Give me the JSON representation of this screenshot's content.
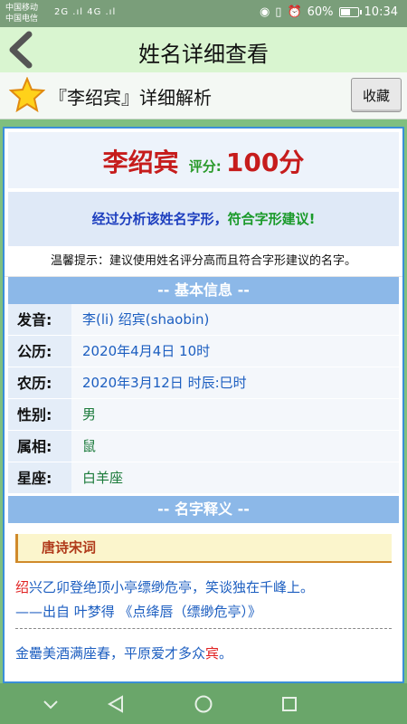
{
  "status": {
    "carrier1": "中国移动",
    "carrier2": "中国电信",
    "signal": "2G .ıl 4G .ıl",
    "battery": "60%",
    "battery_level": 0.6,
    "time": "10:34"
  },
  "header": {
    "title": "姓名详细查看"
  },
  "subheader": {
    "title": "『李绍宾』详细解析",
    "fav_label": "收藏"
  },
  "summary": {
    "name": "李绍宾",
    "score_label": "评分:",
    "score": "100分",
    "analysis_part1": "经过分析该姓名字形，",
    "analysis_part2": "符合字形建议!",
    "tip": "温馨提示：建议使用姓名评分高而且符合字形建议的名字。"
  },
  "basic": {
    "heading": "-- 基本信息 --",
    "rows": [
      {
        "key": "发音:",
        "value": "李(li) 绍宾(shaobin)"
      },
      {
        "key": "公历:",
        "value": "2020年4月4日 10时"
      },
      {
        "key": "农历:",
        "value": "2020年3月12日 时辰:巳时"
      },
      {
        "key": "性别:",
        "value": "男"
      },
      {
        "key": "属相:",
        "value": "鼠"
      },
      {
        "key": "星座:",
        "value": "白羊座"
      }
    ]
  },
  "meaning": {
    "heading": "-- 名字释义 --",
    "poetry_heading": "唐诗宋词",
    "poem1_hl": "绍",
    "poem1_rest": "兴乙卯登绝顶小亭缥缈危亭，笑谈独在千峰上。",
    "poem1_source": "——出自 叶梦得 《点绛唇（缥缈危亭）》",
    "poem2_text": "金罍美酒满座春，平原爱才多众",
    "poem2_hl": "宾",
    "poem2_end": "。"
  },
  "colors": {
    "accent": "#3a8fd8",
    "name_red": "#c61c1c",
    "score_green": "#2a9a2a"
  },
  "icons": {
    "back": "chevron-left-icon",
    "star": "star-icon",
    "nav_down": "chevron-down-icon",
    "nav_back": "triangle-back-icon",
    "nav_home": "circle-home-icon",
    "nav_recent": "square-recent-icon"
  }
}
